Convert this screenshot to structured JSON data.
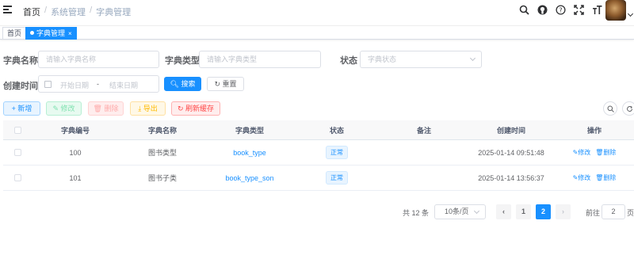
{
  "navbar": {
    "breadcrumb": [
      "首页",
      "系统管理",
      "字典管理"
    ],
    "icons": [
      "search-icon",
      "github-icon",
      "question-icon",
      "fullscreen-icon",
      "font-size-icon"
    ]
  },
  "tags": [
    {
      "label": "首页",
      "active": false
    },
    {
      "label": "字典管理",
      "active": true,
      "close": "×"
    }
  ],
  "search": {
    "dict_name_label": "字典名称",
    "dict_name_placeholder": "请输入字典名称",
    "dict_type_label": "字典类型",
    "dict_type_placeholder": "请输入字典类型",
    "status_label": "状态",
    "status_placeholder": "字典状态",
    "create_time_label": "创建时间",
    "start_date_placeholder": "开始日期",
    "range_separator": "-",
    "end_date_placeholder": "结束日期",
    "search_button": "搜索",
    "reset_button": "重置"
  },
  "toolbar": {
    "add": "新增",
    "edit": "修改",
    "delete": "删除",
    "export": "导出",
    "refresh_cache": "刷新缓存"
  },
  "table": {
    "headers": [
      "字典编号",
      "字典名称",
      "字典类型",
      "状态",
      "备注",
      "创建时间",
      "操作"
    ],
    "rows": [
      {
        "id": "100",
        "name": "图书类型",
        "type": "book_type",
        "status": "正常",
        "remark": "",
        "created": "2025-01-14 09:51:48",
        "edit": "修改",
        "delete": "删除"
      },
      {
        "id": "101",
        "name": "图书子类",
        "type": "book_type_son",
        "status": "正常",
        "remark": "",
        "created": "2025-01-14 13:56:37",
        "edit": "修改",
        "delete": "删除"
      }
    ]
  },
  "pagination": {
    "total": "共 12 条",
    "page_size": "10条/页",
    "pages": [
      "1",
      "2"
    ],
    "current_page": 2,
    "goto_label": "前往",
    "goto_value": "2",
    "page_suffix": "页"
  },
  "colors": {
    "primary": "#1890ff",
    "success": "#13ce66",
    "danger": "#ff4949",
    "warning": "#ffba00"
  }
}
